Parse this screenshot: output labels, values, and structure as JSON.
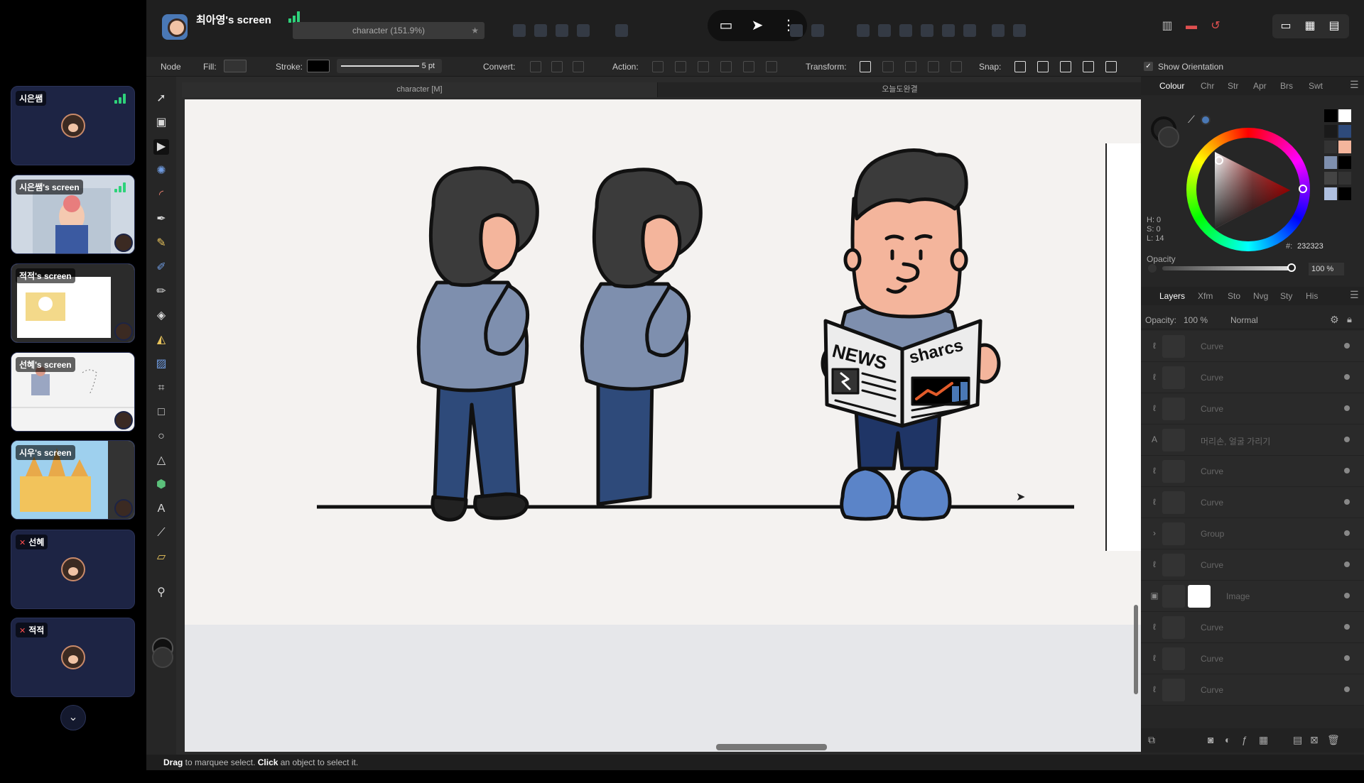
{
  "meeting": {
    "tiles": [
      {
        "label": "시은쌤",
        "type": "avatar",
        "bars": true
      },
      {
        "label": "시은쌤's screen",
        "type": "screen",
        "bars": true
      },
      {
        "label": "적적's screen",
        "type": "screen"
      },
      {
        "label": "선혜's screen",
        "type": "screen"
      },
      {
        "label": "시우's screen",
        "type": "screen"
      },
      {
        "label": "선혜",
        "type": "avatar",
        "muted": true
      },
      {
        "label": "적적",
        "type": "avatar",
        "muted": true
      }
    ],
    "down_icon": "chevron-down-icon"
  },
  "titlebar": {
    "screen_title": "최아영's screen",
    "document_tab": "character (151.9%)"
  },
  "context_bar": {
    "node_label": "Node",
    "fill_label": "Fill:",
    "stroke_label": "Stroke:",
    "stroke_width": "5 pt",
    "convert_label": "Convert:",
    "action_label": "Action:",
    "transform_label": "Transform:",
    "snap_label": "Snap:",
    "show_orientation": "Show Orientation"
  },
  "documents": {
    "tab_1": "character [M]",
    "tab_2": "오늘도완결"
  },
  "illustration": {
    "newspaper_left": "NEWS",
    "newspaper_right": "sharcs"
  },
  "colors": {
    "skin": "#f4b59c",
    "hair": "#3b3b3b",
    "shirt": "#7e8fae",
    "pants": "#2e4a7a",
    "shoe": "#5b84c8",
    "paper": "#ececec",
    "canvas": "#f4f2f0"
  },
  "color_panel": {
    "tabs": [
      "Colour",
      "Chr",
      "Str",
      "Apr",
      "Brs",
      "Swt"
    ],
    "active_tab": "Colour",
    "h": "H: 0",
    "s": "S: 0",
    "l": "L: 14",
    "hex_label": "#:",
    "hex": "232323",
    "opacity_label": "Opacity",
    "opacity_value": "100 %",
    "swatches": [
      "#000000",
      "#ffffff",
      "#1a1a1a",
      "#2e4a7a",
      "#333333",
      "#f4b59c",
      "#7e8fae",
      "#000000",
      "#444444",
      "#333333",
      "#aebfe0",
      "#000000"
    ]
  },
  "layers_panel": {
    "tabs": [
      "Layers",
      "Xfm",
      "Sto",
      "Nvg",
      "Sty",
      "His"
    ],
    "active_tab": "Layers",
    "opacity_label": "Opacity:",
    "opacity_value": "100 %",
    "blend_mode": "Normal",
    "layers": [
      {
        "type": "curve",
        "name": "Curve"
      },
      {
        "type": "curve",
        "name": "Curve"
      },
      {
        "type": "curve",
        "name": "Curve"
      },
      {
        "type": "text",
        "name": "머리손, 얼굴 가리기"
      },
      {
        "type": "curve",
        "name": "Curve"
      },
      {
        "type": "curve",
        "name": "Curve"
      },
      {
        "type": "group",
        "name": "Group"
      },
      {
        "type": "curve",
        "name": "Curve"
      },
      {
        "type": "image",
        "name": "Image"
      },
      {
        "type": "curve",
        "name": "Curve"
      },
      {
        "type": "curve",
        "name": "Curve"
      },
      {
        "type": "curve",
        "name": "Curve"
      }
    ]
  },
  "status": {
    "drag": "Drag",
    "drag_rest": " to marquee select. ",
    "click": "Click",
    "click_rest": " an object to select it."
  }
}
